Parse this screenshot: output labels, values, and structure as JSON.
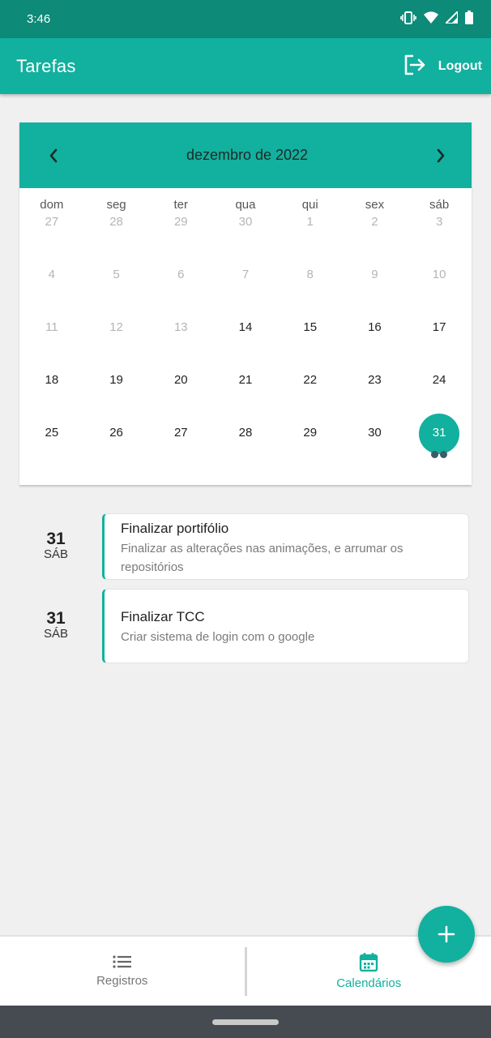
{
  "status_bar": {
    "time": "3:46",
    "icons": [
      "vibrate-icon",
      "wifi-icon",
      "signal-icon",
      "battery-icon"
    ]
  },
  "app_bar": {
    "title": "Tarefas",
    "logout_label": "Logout",
    "logout_icon": "logout-icon"
  },
  "calendar": {
    "month_label": "dezembro de 2022",
    "weekdays": [
      "dom",
      "seg",
      "ter",
      "qua",
      "qui",
      "sex",
      "sáb"
    ],
    "days": [
      {
        "n": "27",
        "muted": true
      },
      {
        "n": "28",
        "muted": true
      },
      {
        "n": "29",
        "muted": true
      },
      {
        "n": "30",
        "muted": true
      },
      {
        "n": "1",
        "muted": true
      },
      {
        "n": "2",
        "muted": true
      },
      {
        "n": "3",
        "muted": true
      },
      {
        "n": "4",
        "muted": true
      },
      {
        "n": "5",
        "muted": true
      },
      {
        "n": "6",
        "muted": true
      },
      {
        "n": "7",
        "muted": true
      },
      {
        "n": "8",
        "muted": true
      },
      {
        "n": "9",
        "muted": true
      },
      {
        "n": "10",
        "muted": true
      },
      {
        "n": "11",
        "muted": true
      },
      {
        "n": "12",
        "muted": true
      },
      {
        "n": "13",
        "muted": true
      },
      {
        "n": "14"
      },
      {
        "n": "15"
      },
      {
        "n": "16"
      },
      {
        "n": "17"
      },
      {
        "n": "18"
      },
      {
        "n": "19"
      },
      {
        "n": "20"
      },
      {
        "n": "21"
      },
      {
        "n": "22"
      },
      {
        "n": "23"
      },
      {
        "n": "24"
      },
      {
        "n": "25"
      },
      {
        "n": "26"
      },
      {
        "n": "27"
      },
      {
        "n": "28"
      },
      {
        "n": "29"
      },
      {
        "n": "30"
      },
      {
        "n": "31",
        "selected": true,
        "events": 2
      }
    ]
  },
  "tasks": [
    {
      "day": "31",
      "weekday": "SÁB",
      "title": "Finalizar portifólio",
      "description": "Finalizar as alterações nas animações, e arrumar os repositórios"
    },
    {
      "day": "31",
      "weekday": "SÁB",
      "title": "Finalizar TCC",
      "description": "Criar sistema de login com o google"
    }
  ],
  "fab": {
    "icon": "plus-icon"
  },
  "bottom_nav": {
    "items": [
      {
        "label": "Registros",
        "icon": "list-icon",
        "active": false
      },
      {
        "label": "Calendários",
        "icon": "calendar-icon",
        "active": true
      }
    ]
  },
  "colors": {
    "primary": "#12b09e",
    "status_bar": "#0d8a78",
    "event_dot": "#3d5a66",
    "background": "#f0f0f0"
  }
}
